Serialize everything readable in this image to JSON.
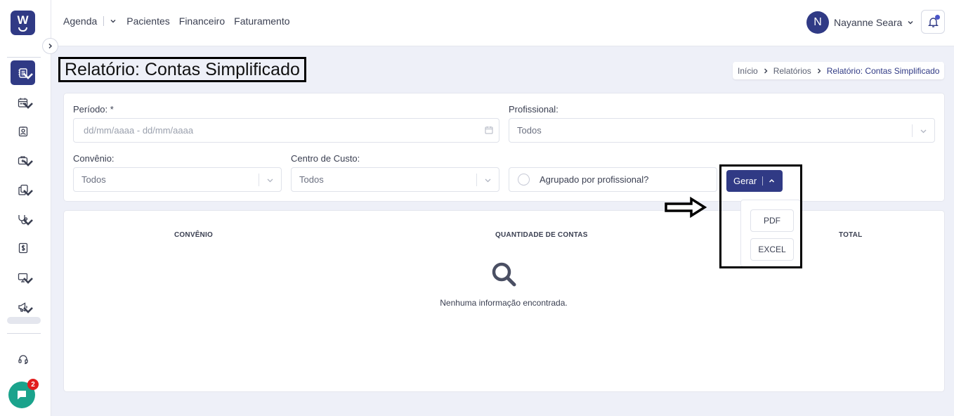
{
  "app": {
    "logo_letter": "W"
  },
  "topnav": {
    "items": [
      "Agenda",
      "Pacientes",
      "Financeiro",
      "Faturamento"
    ]
  },
  "user": {
    "initial": "N",
    "name": "Nayanne Seara"
  },
  "sidebar": {
    "icons": [
      "report-icon",
      "calendar-icon",
      "patient-badge-icon",
      "medical-bag-icon",
      "documents-icon",
      "stethoscope-icon",
      "dollar-icon",
      "monitor-icon",
      "megaphone-icon",
      "headset-icon"
    ],
    "chat_badge": "2"
  },
  "page": {
    "title": "Relatório: Contas Simplificado"
  },
  "breadcrumb": [
    "Início",
    "Relatórios",
    "Relatório: Contas Simplificado"
  ],
  "filters": {
    "periodo_label": "Período: *",
    "periodo_placeholder": "dd/mm/aaaa - dd/mm/aaaa",
    "profissional_label": "Profissional:",
    "profissional_value": "Todos",
    "convenio_label": "Convênio:",
    "convenio_value": "Todos",
    "centro_label": "Centro de Custo:",
    "centro_value": "Todos",
    "agrupado_label": "Agrupado por profissional?"
  },
  "actions": {
    "gerar_label": "Gerar",
    "dropdown": [
      "PDF",
      "EXCEL"
    ]
  },
  "table": {
    "columns": [
      "CONVÊNIO",
      "QUANTIDADE DE CONTAS",
      "TOTAL"
    ],
    "empty_message": "Nenhuma informação encontrada."
  },
  "colors": {
    "primary": "#303a85",
    "chat": "#1aa38c",
    "badge": "#e11d1d",
    "background": "#eef0f8"
  }
}
